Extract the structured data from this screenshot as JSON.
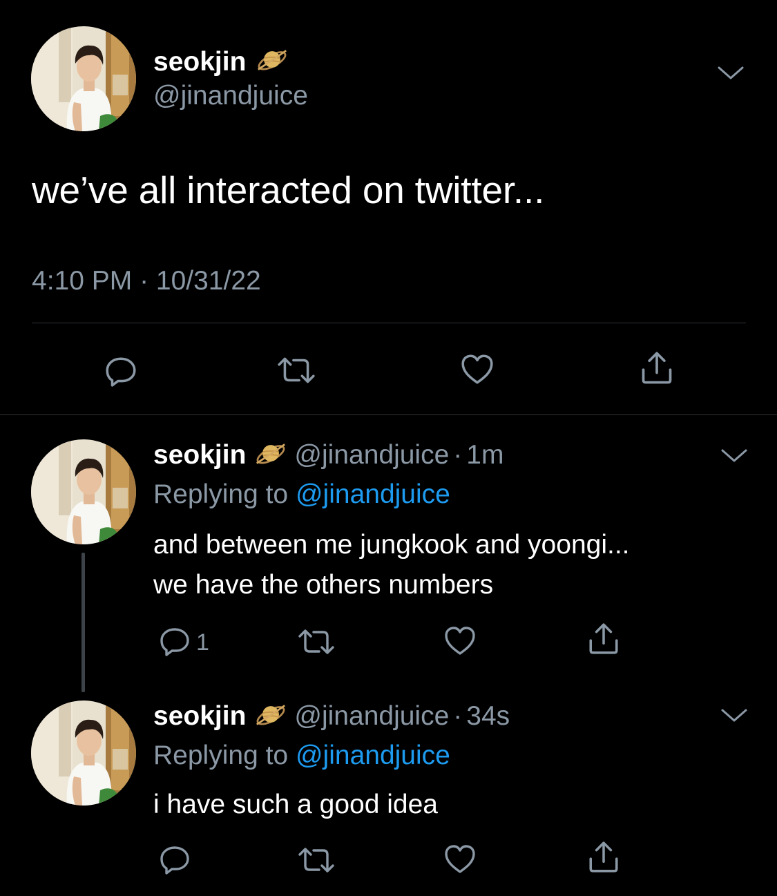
{
  "main_tweet": {
    "display_name": "seokjin",
    "handle": "@jinandjuice",
    "text": "we’ve all interacted on twitter...",
    "timestamp": "4:10 PM · 10/31/22",
    "badge_icon": "saturn-emoji-icon"
  },
  "replies": [
    {
      "display_name": "seokjin",
      "handle": "@jinandjuice",
      "separator": "·",
      "time": "1m",
      "replying_prefix": "Replying to ",
      "replying_to": "@jinandjuice",
      "text_lines": [
        "and between me jungkook and yoongi...",
        "we have the others numbers"
      ],
      "reply_count": "1"
    },
    {
      "display_name": "seokjin",
      "handle": "@jinandjuice",
      "separator": "·",
      "time": "34s",
      "replying_prefix": "Replying to ",
      "replying_to": "@jinandjuice",
      "text_lines": [
        "i have such a good idea"
      ],
      "reply_count": ""
    }
  ],
  "colors": {
    "background": "#000000",
    "text_primary": "#ffffff",
    "text_secondary": "#8b98a5",
    "link": "#1d9bf0",
    "divider": "#2f3336"
  }
}
